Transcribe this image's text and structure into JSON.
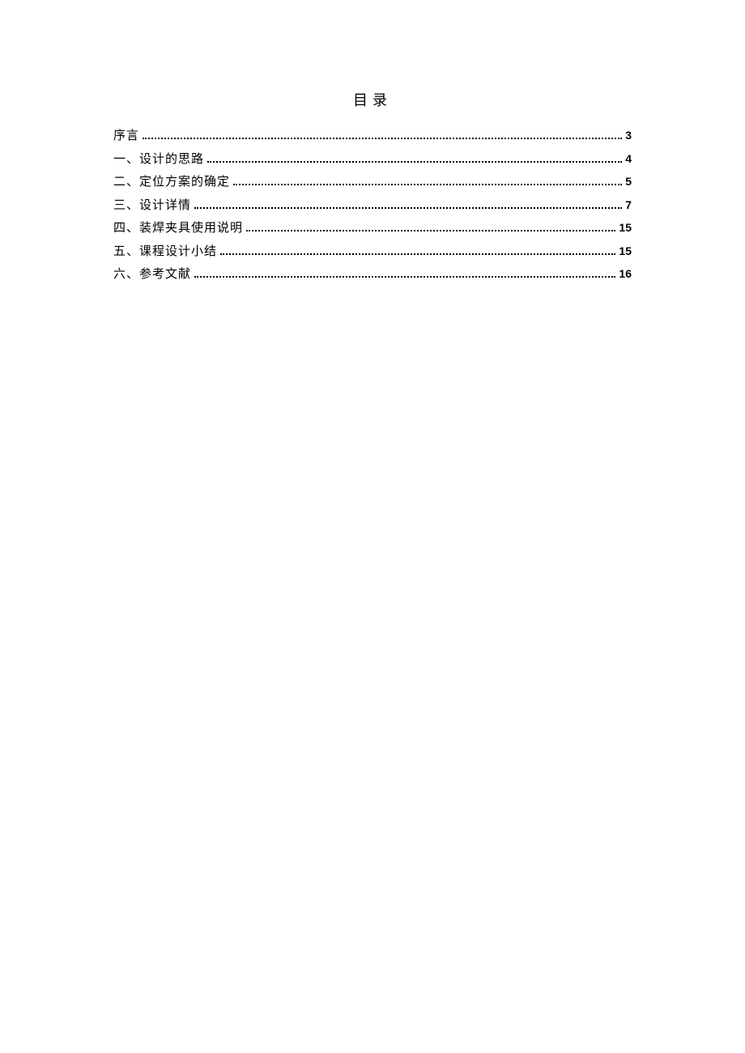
{
  "title": "目录",
  "toc": [
    {
      "label": "序言",
      "page": "3"
    },
    {
      "label": "一、设计的思路",
      "page": "4"
    },
    {
      "label": "二、定位方案的确定",
      "page": "5"
    },
    {
      "label": "三、设计详情",
      "page": "7"
    },
    {
      "label": "四、装焊夹具使用说明",
      "page": "15"
    },
    {
      "label": "五、课程设计小结",
      "page": "15"
    },
    {
      "label": "六、参考文献",
      "page": "16"
    }
  ]
}
